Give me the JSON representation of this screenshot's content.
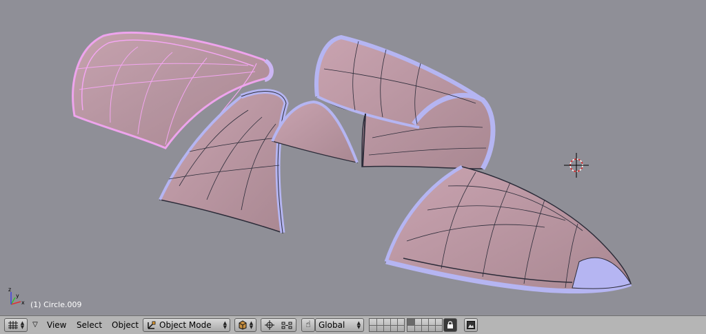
{
  "viewport": {
    "object_info": "(1) Circle.009",
    "axis_labels": {
      "x": "x",
      "y": "y",
      "z": "z"
    }
  },
  "toolbar": {
    "view_menu": "View",
    "select_menu": "Select",
    "object_menu": "Object",
    "mode_select": "Object Mode",
    "orientation_select": "Global"
  },
  "icons": {
    "editor_type": "grid-icon",
    "menu_collapse": "triangle-down-icon",
    "mode": "object-mode-icon",
    "draw_type": "solid-cube-icon",
    "pivot": "pivot-crosshair-icon",
    "manipulator": "hand-icon",
    "lock": "lock-icon",
    "render": "render-preview-icon"
  },
  "colors": {
    "viewport_bg": "#8f8f97",
    "mesh_fill": "#c39ca9",
    "mesh_wire": "#2b2b38",
    "mesh_edge": "#b5b5f2",
    "selected_wire": "#f4a6f2",
    "header_bg": "#b5b5b5"
  }
}
